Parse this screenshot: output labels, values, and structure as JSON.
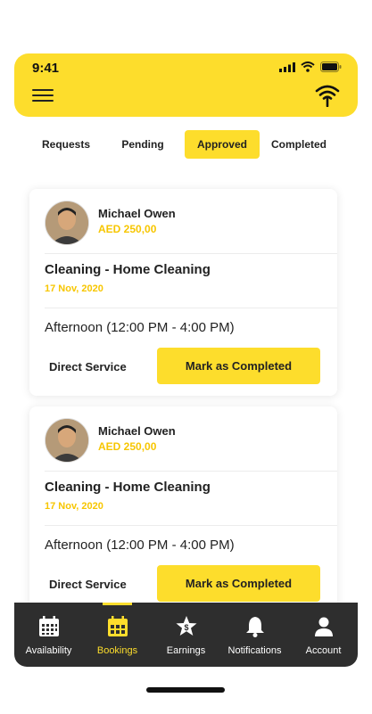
{
  "status_bar": {
    "time": "9:41"
  },
  "header": {
    "menu_icon": "hamburger-icon",
    "wifi_icon": "wifi-signal-icon"
  },
  "tabs": [
    {
      "label": "Requests",
      "active": false
    },
    {
      "label": "Pending",
      "active": false
    },
    {
      "label": "Approved",
      "active": true
    },
    {
      "label": "Completed",
      "active": false
    }
  ],
  "bookings": [
    {
      "name": "Michael Owen",
      "price": "AED 250,00",
      "service": "Cleaning - Home Cleaning",
      "date": "17 Nov, 2020",
      "slot": "Afternoon (12:00 PM - 4:00 PM)",
      "type": "Direct Service",
      "action": "Mark as Completed"
    },
    {
      "name": "Michael Owen",
      "price": "AED 250,00",
      "service": "Cleaning - Home Cleaning",
      "date": "17 Nov, 2020",
      "slot": "Afternoon (12:00 PM - 4:00 PM)",
      "type": "Direct Service",
      "action": "Mark as Completed"
    }
  ],
  "bottom_nav": [
    {
      "label": "Availability",
      "icon": "calendar-grid-icon",
      "active": false
    },
    {
      "label": "Bookings",
      "icon": "calendar-icon",
      "active": true
    },
    {
      "label": "Earnings",
      "icon": "star-dollar-icon",
      "active": false
    },
    {
      "label": "Notifications",
      "icon": "bell-icon",
      "active": false
    },
    {
      "label": "Account",
      "icon": "user-icon",
      "active": false
    }
  ],
  "colors": {
    "accent": "#FDDD2C",
    "price": "#F7C600",
    "nav_bg": "#2e2e2e"
  }
}
